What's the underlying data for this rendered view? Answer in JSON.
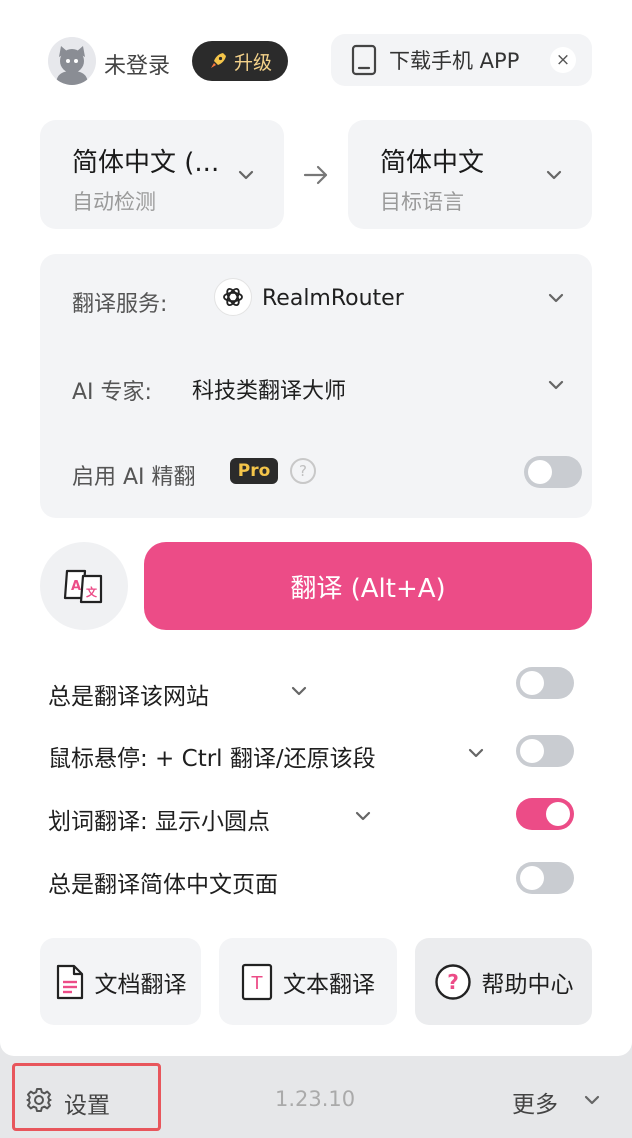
{
  "header": {
    "user_name": "未登录",
    "upgrade_label": "升级",
    "app_download_label": "下载手机 APP",
    "close_glyph": "×"
  },
  "languages": {
    "source": {
      "title": "简体中文 (...",
      "subtitle": "自动检测"
    },
    "arrow_glyph": "→",
    "target": {
      "title": "简体中文",
      "subtitle": "目标语言"
    }
  },
  "service": {
    "service_label": "翻译服务:",
    "service_value": "RealmRouter",
    "expert_label": "AI 专家:",
    "expert_value": "科技类翻译大师",
    "ai_refine_label": "启用 AI 精翻",
    "pro_badge": "Pro",
    "help_glyph": "?",
    "ai_refine_on": false
  },
  "translate_button": "翻译 (Alt+A)",
  "options": [
    {
      "label": "总是翻译该网站",
      "on": false
    },
    {
      "label": "鼠标悬停:  + Ctrl 翻译/还原该段",
      "on": false
    },
    {
      "label": "划词翻译:  显示小圆点",
      "on": true
    },
    {
      "label": "总是翻译简体中文页面",
      "on": false
    }
  ],
  "tools": {
    "doc": "文档翻译",
    "text": "文本翻译",
    "help": "帮助中心",
    "text_icon_letter": "T",
    "help_icon_glyph": "?"
  },
  "footer": {
    "settings": "设置",
    "version": "1.23.10",
    "more": "更多"
  },
  "colors": {
    "accent": "#ec4c87",
    "toggle_off": "#c9ccd1",
    "highlight_border": "#e8565c"
  }
}
